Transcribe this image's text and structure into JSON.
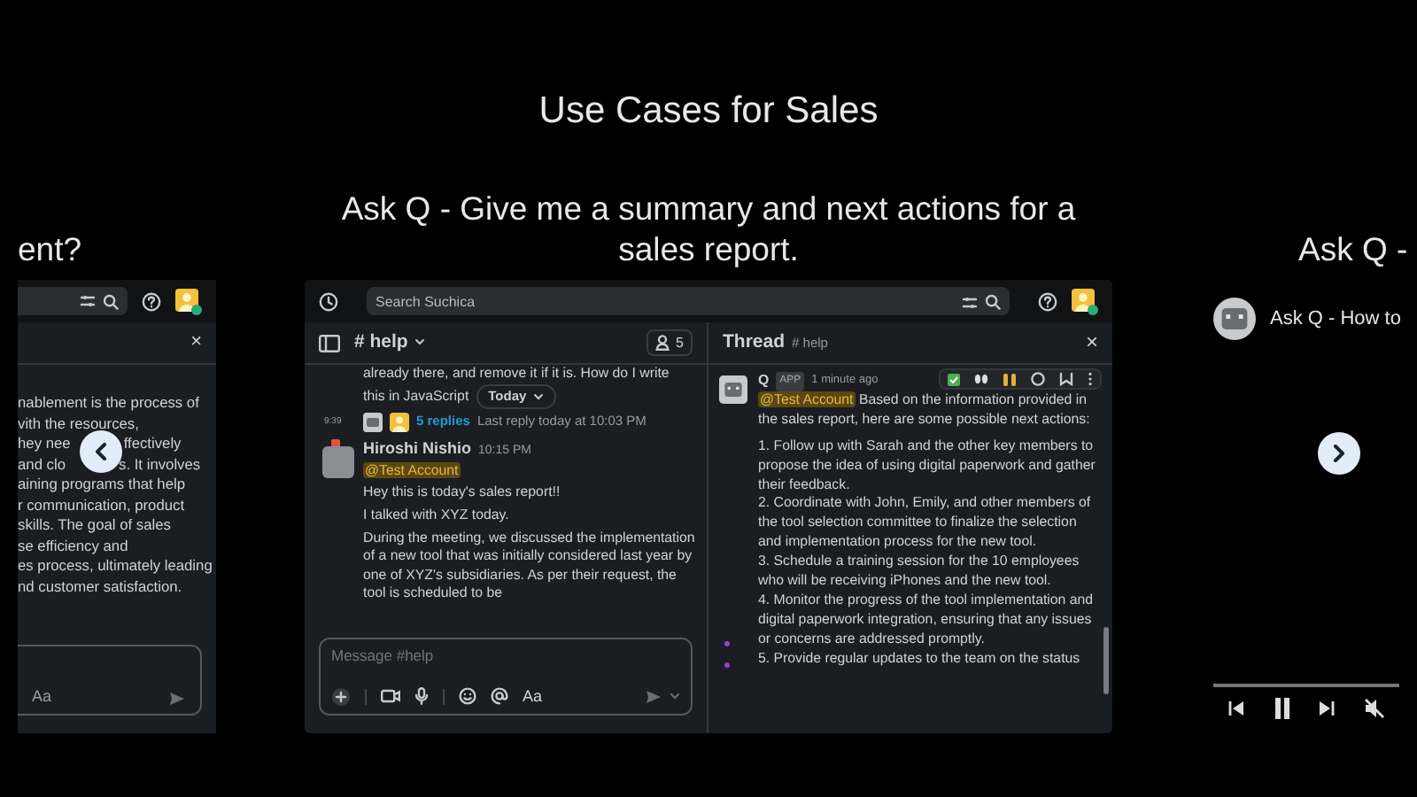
{
  "title": "Use Cases for Sales",
  "left_slide": {
    "caption": "ent?",
    "close": "×",
    "text_lines": [
      [
        "nablement is the process of"
      ],
      [
        "vith the resources,"
      ],
      [
        "hey nee",
        "ffectively"
      ],
      [
        "and clo",
        "s. It involves"
      ],
      [
        "aining programs that help"
      ],
      [
        "r communication, product"
      ],
      [
        "skills. The goal of sales"
      ],
      [
        "se efficiency and"
      ],
      [
        "es process, ultimately leading"
      ],
      [
        "nd customer satisfaction."
      ]
    ],
    "composer_format": "Aa"
  },
  "main_slide": {
    "caption": "Ask Q - Give me a summary and next actions for a sales report.",
    "search_placeholder": "Search Suchica",
    "channel": {
      "name": "# help",
      "members": "5"
    },
    "earlier_message": [
      "already there, and remove it if it is. How do I write",
      "this in JavaScript"
    ],
    "date_divider": "Today",
    "thread_summary": {
      "time": "9:39",
      "replies": "5 replies",
      "last_reply": "Last reply today at 10:03 PM"
    },
    "post": {
      "author": "Hiroshi Nishio",
      "time": "10:15 PM",
      "mention": "@Test Account",
      "paragraphs": [
        "Hey this is today's sales report!!",
        "I talked with XYZ today.",
        "During the meeting, we discussed the implementation of a new tool that was initially considered last year by one of XYZ's subsidiaries. As per their request, the tool is scheduled to be"
      ]
    },
    "composer": {
      "placeholder": "Message #help",
      "format": "Aa"
    },
    "thread": {
      "title": "Thread",
      "channel": "# help",
      "close": "×",
      "author": "Q",
      "badge": "APP",
      "time": "1 minute ago",
      "mention": "@Test Account",
      "intro": " Based on the information provided in the sales report, here are some possible next actions:",
      "items": [
        "1. Follow up with Sarah and the other key members to propose the idea of using digital paperwork and gather their feedback.",
        "2. Coordinate with John, Emily, and other members of the tool selection committee to finalize the selection and implementation process for the new tool.",
        "3. Schedule a training session for the 10 employees who will be receiving iPhones and the new tool.",
        "4. Monitor the progress of the tool implementation and digital paperwork integration, ensuring that any issues or concerns are addressed promptly.",
        "5. Provide regular updates to the team on the status"
      ]
    }
  },
  "right_slide": {
    "caption": "Ask Q -",
    "video_title": "Ask Q - How to",
    "playing": true,
    "muted": true
  }
}
